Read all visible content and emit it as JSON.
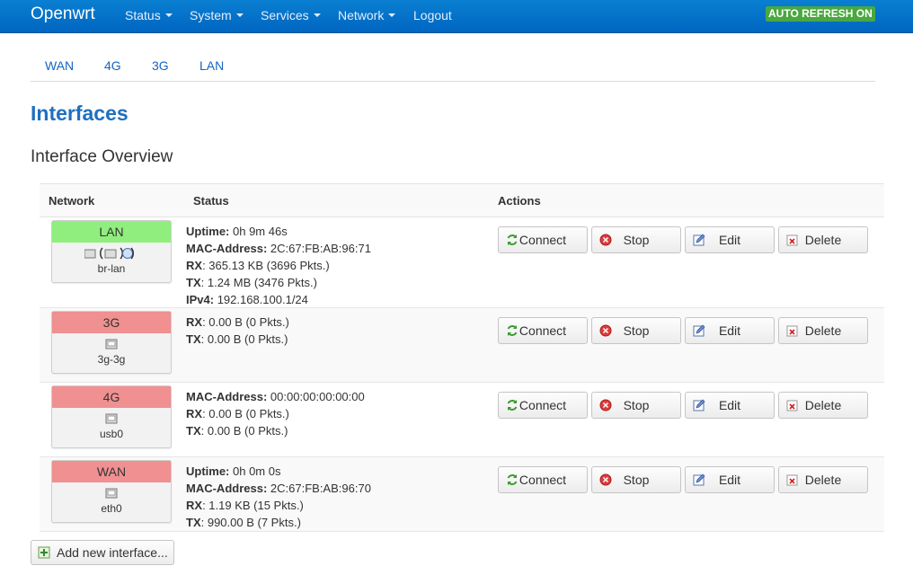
{
  "navbar": {
    "brand": "Openwrt",
    "menus": [
      {
        "label": "Status",
        "dropdown": true
      },
      {
        "label": "System",
        "dropdown": true
      },
      {
        "label": "Services",
        "dropdown": true
      },
      {
        "label": "Network",
        "dropdown": true
      },
      {
        "label": "Logout",
        "dropdown": false
      }
    ],
    "auto_refresh": "AUTO REFRESH ON"
  },
  "tabs": [
    "WAN",
    "4G",
    "3G",
    "LAN"
  ],
  "page_title": "Interfaces",
  "section_title": "Interface Overview",
  "table": {
    "headers": {
      "network": "Network",
      "status": "Status",
      "actions": "Actions"
    },
    "rows": [
      {
        "name": "LAN",
        "state": "up",
        "device": "br-lan",
        "status": [
          {
            "key": "Uptime:",
            "value": " 0h 9m 46s"
          },
          {
            "key": "MAC-Address:",
            "value": " 2C:67:FB:AB:96:71"
          },
          {
            "key": "RX",
            "value": ": 365.13 KB (3696 Pkts.)"
          },
          {
            "key": "TX",
            "value": ": 1.24 MB (3476 Pkts.)"
          },
          {
            "key": "IPv4:",
            "value": " 192.168.100.1/24"
          }
        ]
      },
      {
        "name": "3G",
        "state": "down",
        "device": "3g-3g",
        "status": [
          {
            "key": "RX",
            "value": ": 0.00 B (0 Pkts.)"
          },
          {
            "key": "TX",
            "value": ": 0.00 B (0 Pkts.)"
          }
        ]
      },
      {
        "name": "4G",
        "state": "down",
        "device": "usb0",
        "status": [
          {
            "key": "MAC-Address:",
            "value": " 00:00:00:00:00:00"
          },
          {
            "key": "RX",
            "value": ": 0.00 B (0 Pkts.)"
          },
          {
            "key": "TX",
            "value": ": 0.00 B (0 Pkts.)"
          }
        ]
      },
      {
        "name": "WAN",
        "state": "down",
        "device": "eth0",
        "status": [
          {
            "key": "Uptime:",
            "value": " 0h 0m 0s"
          },
          {
            "key": "MAC-Address:",
            "value": " 2C:67:FB:AB:96:70"
          },
          {
            "key": "RX",
            "value": ": 1.19 KB (15 Pkts.)"
          },
          {
            "key": "TX",
            "value": ": 990.00 B (7 Pkts.)"
          }
        ]
      }
    ],
    "action_labels": {
      "connect": "Connect",
      "stop": "Stop",
      "edit": "Edit",
      "delete": "Delete"
    }
  },
  "add_interface": "Add new interface...",
  "colors": {
    "navbar": "#0a6fc9",
    "up": "#90ee7e",
    "down": "#f09090",
    "accent": "#1f6fc0",
    "badge": "#49a840"
  }
}
